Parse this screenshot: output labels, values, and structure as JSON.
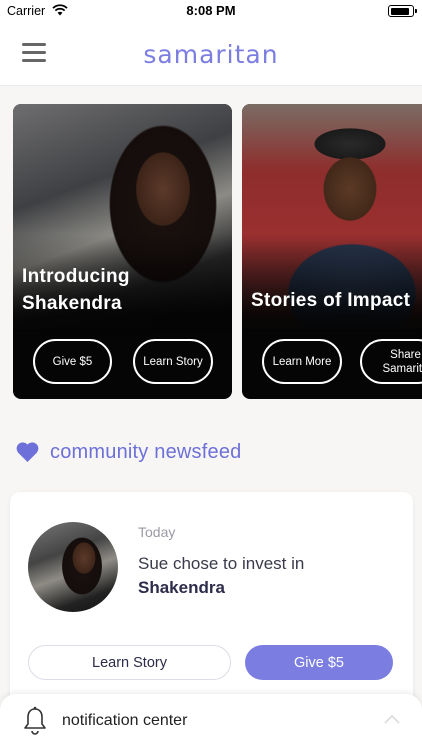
{
  "status_bar": {
    "carrier": "Carrier",
    "time": "8:08 PM"
  },
  "nav": {
    "title": "samaritan"
  },
  "carousel": [
    {
      "title": "Introducing Shakendra",
      "primary_button": "Give $5",
      "secondary_button": "Learn Story"
    },
    {
      "title": "Stories of Impact",
      "primary_button": "Learn More",
      "secondary_button": "Share Samarita"
    }
  ],
  "section": {
    "label": "community newsfeed"
  },
  "feed": {
    "time": "Today",
    "text_prefix": "Sue chose to invest in ",
    "text_name": "Shakendra",
    "learn_button": "Learn Story",
    "give_button": "Give $5"
  },
  "notifications": {
    "label": "notification center"
  },
  "colors": {
    "accent": "#7b7ee0",
    "heart": "#6d70d8"
  }
}
